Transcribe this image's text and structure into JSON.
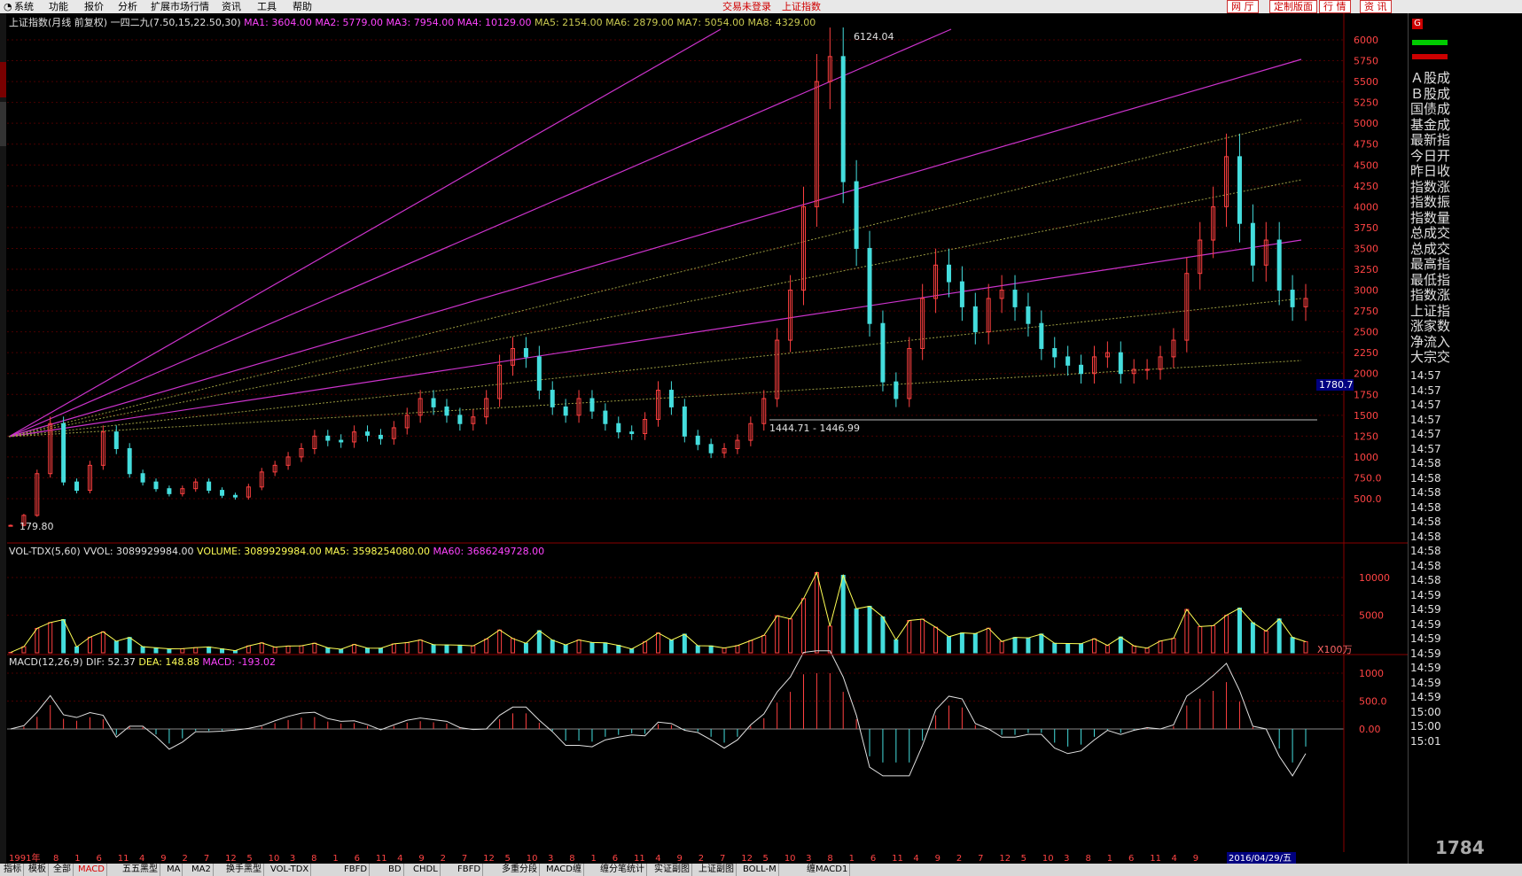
{
  "menu": [
    "系统",
    "功能",
    "报价",
    "分析",
    "扩展市场行情",
    "资讯",
    "工具",
    "帮助"
  ],
  "status": {
    "login": "交易未登录",
    "index_name": "上证指数"
  },
  "top_buttons": [
    "网 厅",
    "定制版面",
    "行 情",
    "资 讯"
  ],
  "main_header": {
    "title": "上证指数(月线 前复权) 一四二九(7.50,15,22.50,30)",
    "ma": [
      {
        "label": "MA1: 3604.00",
        "color": "#ff44ff"
      },
      {
        "label": "MA2: 5779.00",
        "color": "#ff44ff"
      },
      {
        "label": "MA3: 7954.00",
        "color": "#ff44ff"
      },
      {
        "label": "MA4: 10129.00",
        "color": "#ff44ff"
      },
      {
        "label": "MA5: 2154.00",
        "color": "#c8c850"
      },
      {
        "label": "MA6: 2879.00",
        "color": "#c8c850"
      },
      {
        "label": "MA7: 5054.00",
        "color": "#c8c850"
      },
      {
        "label": "MA8: 4329.00",
        "color": "#c8c850"
      }
    ]
  },
  "price_axis": [
    "6000",
    "5750",
    "5500",
    "5250",
    "5000",
    "4750",
    "4500",
    "4250",
    "4000",
    "3750",
    "3500",
    "3250",
    "3000",
    "2750",
    "2500",
    "2250",
    "2000",
    "1750",
    "1500",
    "1250",
    "1000",
    "750.0",
    "500.0"
  ],
  "annotations": {
    "high": "6124.04",
    "low_start": "179.80",
    "range": "1444.71 - 1446.99",
    "current": "1780.7"
  },
  "volume_header": {
    "name": "VOL-TDX(5,60)",
    "items": [
      {
        "label": "VVOL: 3089929984.00",
        "color": "#e0e0e0"
      },
      {
        "label": "VOLUME: 3089929984.00",
        "color": "#ffff55"
      },
      {
        "label": "MA5: 3598254080.00",
        "color": "#ffff55"
      },
      {
        "label": "MA60: 3686249728.00",
        "color": "#ff44ff"
      }
    ]
  },
  "volume_axis": [
    "10000",
    "5000"
  ],
  "volume_unit": "X100万",
  "macd_header": {
    "name": "MACD(12,26,9)",
    "items": [
      {
        "label": "DIF: 52.37",
        "color": "#e0e0e0"
      },
      {
        "label": "DEA: 148.88",
        "color": "#ffff55"
      },
      {
        "label": "MACD: -193.02",
        "color": "#ff44ff"
      }
    ]
  },
  "macd_axis": [
    "1000",
    "500.0",
    "0.00"
  ],
  "date_axis": {
    "start": "1991年",
    "ticks": [
      "8",
      "1",
      "6",
      "11",
      "4",
      "9",
      "2",
      "7",
      "12",
      "5",
      "10",
      "3",
      "8",
      "1",
      "6",
      "11",
      "4",
      "9",
      "2",
      "7",
      "12",
      "5",
      "10",
      "3",
      "8",
      "1",
      "6",
      "11",
      "4",
      "9",
      "2",
      "7",
      "12",
      "5",
      "10",
      "3",
      "8",
      "1",
      "6",
      "11",
      "4",
      "9",
      "2",
      "7",
      "12",
      "5",
      "10",
      "3",
      "8",
      "1",
      "6",
      "11",
      "4",
      "9"
    ],
    "end": "2016/04/29/五"
  },
  "right_panel": {
    "labels": [
      "Ａ股成",
      "Ｂ股成",
      "国债成",
      "基金成",
      "最新指",
      "今日开",
      "昨日收",
      "指数涨",
      "指数振",
      "指数量",
      "总成交",
      "总成交",
      "最高指",
      "最低指",
      "指数涨",
      "上证指",
      "涨家数",
      "净流入",
      "大宗交"
    ],
    "times": [
      "14:57",
      "14:57",
      "14:57",
      "14:57",
      "14:57",
      "14:57",
      "14:58",
      "14:58",
      "14:58",
      "14:58",
      "14:58",
      "14:58",
      "14:58",
      "14:58",
      "14:58",
      "14:59",
      "14:59",
      "14:59",
      "14:59",
      "14:59",
      "14:59",
      "14:59",
      "14:59",
      "15:00",
      "15:00",
      "15:01"
    ],
    "watermark": "1784"
  },
  "bottom_tabs": [
    "指标",
    "模板",
    "全部",
    "MACD",
    "五五黑型",
    "MA",
    "MA2",
    "换手黑型",
    "VOL-TDX",
    "FBFD",
    "BD",
    "CHDL",
    "FBFD",
    "多重分段",
    "MACD缠",
    "缠分笔统计",
    "实证副图",
    "上证副图",
    "BOLL-M",
    "缠MACD1"
  ],
  "colors": {
    "up": "#ff4040",
    "down": "#44dddd",
    "fan": "#cc33cc",
    "dotted": "#9a9a40",
    "grid": "#4a0000"
  },
  "chart_data": {
    "type": "candlestick",
    "close_series": [
      180,
      300,
      800,
      1400,
      700,
      600,
      900,
      1300,
      1100,
      800,
      700,
      620,
      560,
      620,
      700,
      600,
      540,
      520,
      640,
      820,
      900,
      1000,
      1100,
      1250,
      1200,
      1180,
      1300,
      1260,
      1220,
      1350,
      1500,
      1700,
      1600,
      1500,
      1400,
      1480,
      1700,
      2100,
      2300,
      2200,
      1800,
      1600,
      1500,
      1700,
      1550,
      1400,
      1300,
      1280,
      1450,
      1800,
      1600,
      1250,
      1150,
      1050,
      1100,
      1200,
      1400,
      1700,
      2400,
      3000,
      4000,
      5500,
      5800,
      4300,
      3500,
      2600,
      1900,
      1700,
      2300,
      2900,
      3300,
      3100,
      2800,
      2500,
      2900,
      3000,
      2800,
      2600,
      2300,
      2200,
      2100,
      2000,
      2200,
      2250,
      2000,
      2050,
      2050,
      2200,
      2400,
      3200,
      3600,
      4000,
      4600,
      3800,
      3300,
      3600,
      3000,
      2800,
      2900
    ],
    "fan_lines": 4,
    "volume_peak": 12000,
    "macd_peak": 1000
  }
}
